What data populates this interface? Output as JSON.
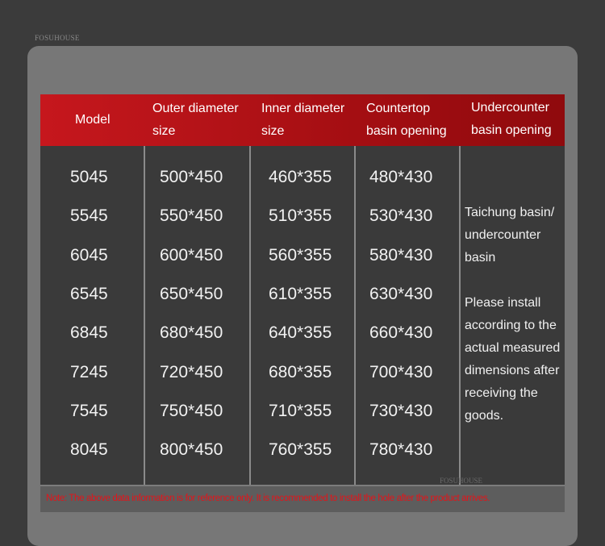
{
  "brand": "FOSUHOUSE",
  "watermark": "FOSUHOUSE",
  "headers": {
    "model": "Model",
    "outer_line1": "Outer diameter",
    "outer_line2": "size",
    "inner_line1": "Inner diameter",
    "inner_line2": "size",
    "countertop_line1": "Countertop",
    "countertop_line2": "basin opening",
    "undercounter_line1": "Undercounter",
    "undercounter_line2": "basin opening"
  },
  "rows": [
    {
      "model": "5045",
      "outer": "500*450",
      "inner": "460*355",
      "countertop": "480*430"
    },
    {
      "model": "5545",
      "outer": "550*450",
      "inner": "510*355",
      "countertop": "530*430"
    },
    {
      "model": "6045",
      "outer": "600*450",
      "inner": "560*355",
      "countertop": "580*430"
    },
    {
      "model": "6545",
      "outer": "650*450",
      "inner": "610*355",
      "countertop": "630*430"
    },
    {
      "model": "6845",
      "outer": "680*450",
      "inner": "640*355",
      "countertop": "660*430"
    },
    {
      "model": "7245",
      "outer": "720*450",
      "inner": "680*355",
      "countertop": "700*430"
    },
    {
      "model": "7545",
      "outer": "750*450",
      "inner": "710*355",
      "countertop": "730*430"
    },
    {
      "model": "8045",
      "outer": "800*450",
      "inner": "760*355",
      "countertop": "780*430"
    }
  ],
  "undercounter_note": {
    "line1": "Taichung basin/ undercounter basin",
    "line2": "Please install according to the actual measured dimensions after receiving the goods."
  },
  "footer_note": "Note: The above data information is for reference only. It is recommended to install the hole after the product arrives."
}
